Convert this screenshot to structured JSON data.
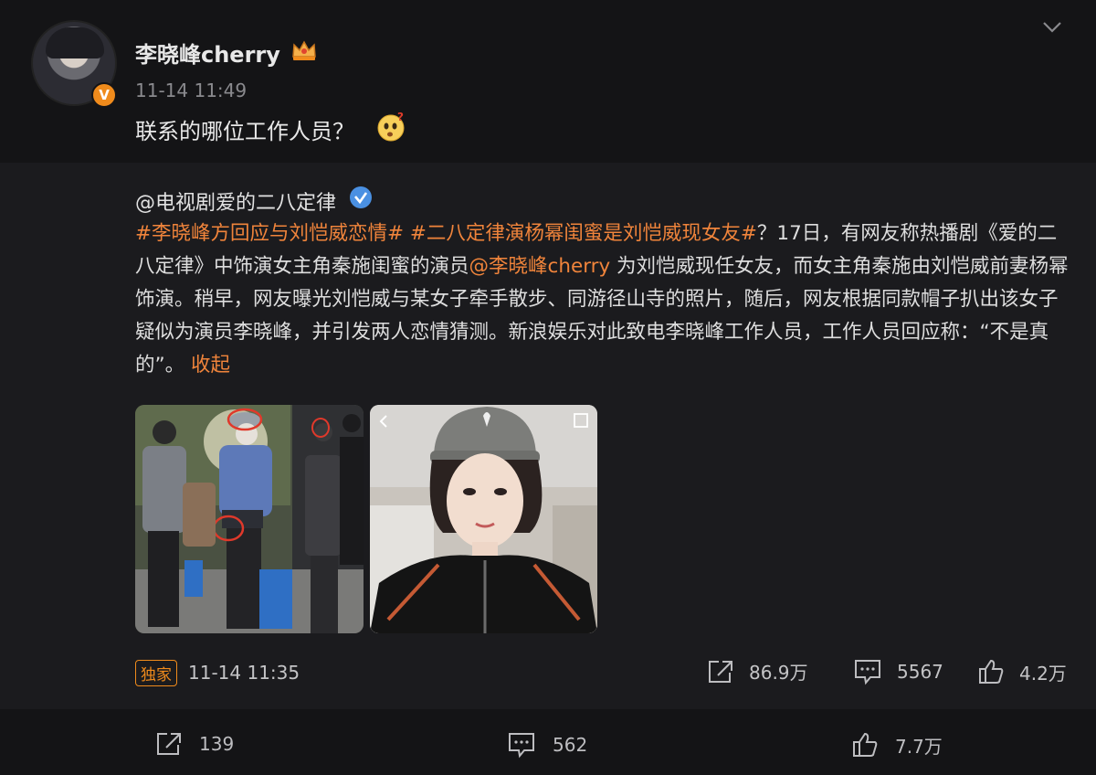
{
  "post": {
    "username": "李晓峰cherry",
    "time": "11-14 11:49",
    "text": "联系的哪位工作人员？",
    "verified_badge": "V",
    "icons": {
      "crown": "crown-icon",
      "emoji": "thinking-face-emoji",
      "chevron": "chevron-down-icon"
    }
  },
  "repost": {
    "author": "@电视剧爱的二八定律",
    "tag1": "#李晓峰方回应与刘恺威恋情#",
    "tag2": "#二八定律演杨幂闺蜜是刘恺威现女友#",
    "text_part1": "？17日，有网友称热播剧《爱的二八定律》中饰演女主角秦施闺蜜的演员",
    "mention": "@李晓峰cherry",
    "text_part2": " 为刘恺威现任女友，而女主角秦施由刘恺威前妻杨幂饰演。稍早，网友曝光刘恺威与某女子牵手散步、同游径山寺的照片，随后，网友根据同款帽子扒出该女子疑似为演员李晓峰，并引发两人恋情猜测。新浪娱乐对此致电李晓峰工作人员，工作人员回应称：“不是真的”。",
    "collapse": "收起",
    "exclusive_badge": "独家",
    "time": "11-14 11:35",
    "stats": {
      "reposts": "86.9万",
      "comments": "5567",
      "likes": "4.2万"
    }
  },
  "bottom": {
    "reposts": "139",
    "comments": "562",
    "likes": "7.7万"
  },
  "colors": {
    "accent": "#f0843b",
    "badge_orange": "#f08b1c",
    "verified_blue": "#4a90e2",
    "bg": "#141416",
    "card_bg": "#1b1b1e"
  }
}
